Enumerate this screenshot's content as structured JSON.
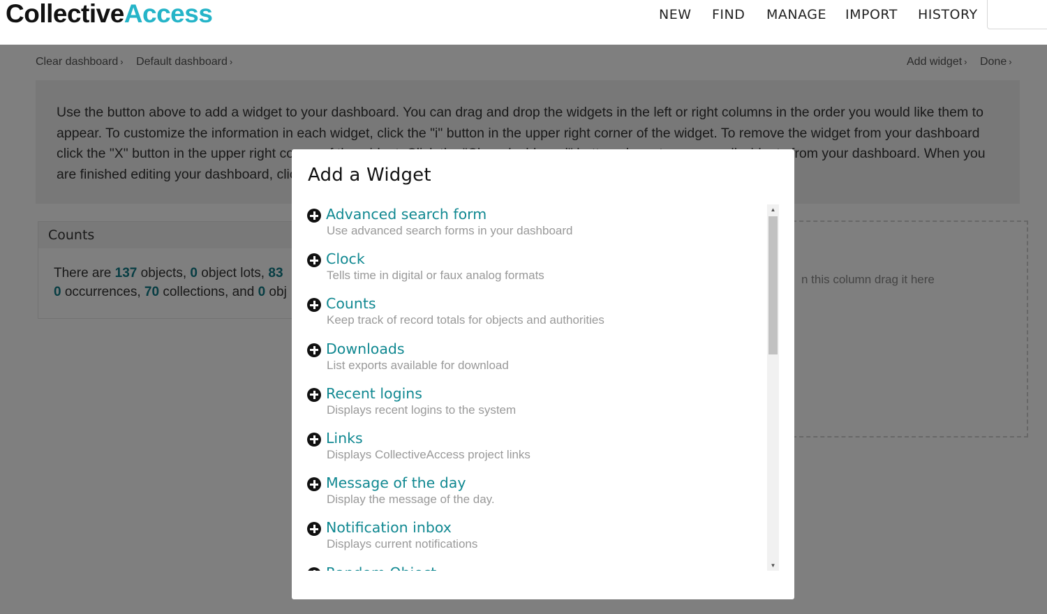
{
  "header": {
    "logo_part1": "Collective",
    "logo_part2": "Access",
    "nav": [
      "NEW",
      "FIND",
      "MANAGE",
      "IMPORT",
      "HISTORY"
    ]
  },
  "dashboard": {
    "breadcrumbs_left": [
      "Clear dashboard",
      "Default dashboard"
    ],
    "breadcrumbs_right": [
      "Add widget",
      "Done"
    ],
    "chevron": "›",
    "help_text": "Use the button above to add a widget to your dashboard. You can drag and drop the widgets in the left or right columns in the order you would like them to appear. To customize the information in each widget, click the \"i\" button in the upper right corner of the widget. To remove the widget from your dashboard click the \"X\" button in the upper right corner of the widget. Click the \"Clear dashboard\" button above to remove all widgets from your dashboard. When you are finished editing your dashboard, click the \"Done\" button.",
    "counts_widget": {
      "title": "Counts",
      "line1_parts": [
        "There are ",
        "137",
        " objects, ",
        "0",
        " object lots, ",
        "83"
      ],
      "line2_parts": [
        "0",
        " occurrences, ",
        "70",
        " collections, and ",
        "0",
        " obj"
      ]
    },
    "drop_hint": "n this column drag it here"
  },
  "modal": {
    "title": "Add a Widget",
    "widgets": [
      {
        "title": "Advanced search form",
        "description": "Use advanced search forms in your dashboard"
      },
      {
        "title": "Clock",
        "description": "Tells time in digital or faux analog formats"
      },
      {
        "title": "Counts",
        "description": "Keep track of record totals for objects and authorities"
      },
      {
        "title": "Downloads",
        "description": "List exports available for download"
      },
      {
        "title": "Recent logins",
        "description": "Displays recent logins to the system"
      },
      {
        "title": "Links",
        "description": "Displays CollectiveAccess project links"
      },
      {
        "title": "Message of the day",
        "description": "Display the message of the day."
      },
      {
        "title": "Notification inbox",
        "description": "Displays current notifications"
      },
      {
        "title": "Random Object",
        "description": ""
      }
    ],
    "scroll_up_glyph": "▲",
    "scroll_down_glyph": "▼"
  },
  "colors": {
    "accent": "#25b4c8",
    "link": "#108891",
    "overlay": "rgba(0,0,0,0.5)"
  }
}
